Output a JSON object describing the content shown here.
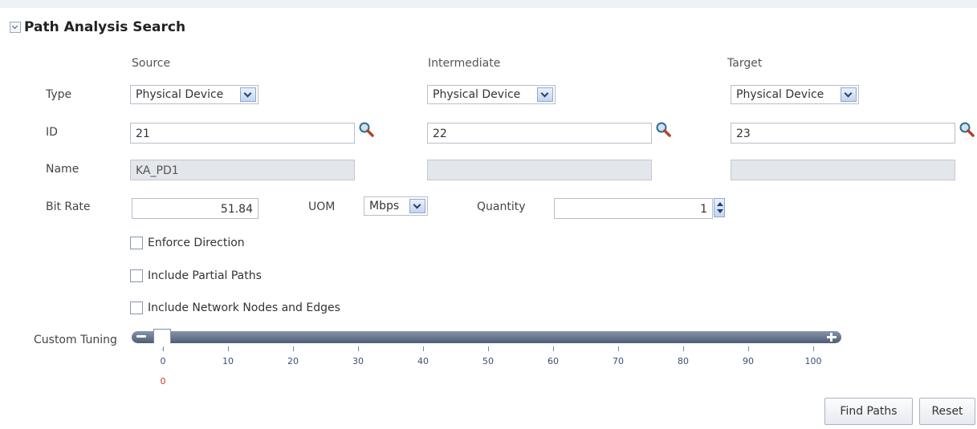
{
  "section": {
    "title": "Path Analysis Search"
  },
  "columns": {
    "source": "Source",
    "intermediate": "Intermediate",
    "target": "Target"
  },
  "labels": {
    "type": "Type",
    "id": "ID",
    "name": "Name",
    "bit_rate": "Bit Rate",
    "uom": "UOM",
    "quantity": "Quantity",
    "custom_tuning": "Custom Tuning"
  },
  "source": {
    "type": "Physical Device",
    "id": "21",
    "name": "KA_PD1"
  },
  "intermediate": {
    "type": "Physical Device",
    "id": "22",
    "name": ""
  },
  "target": {
    "type": "Physical Device",
    "id": "23",
    "name": ""
  },
  "bit_rate": "51.84",
  "uom": "Mbps",
  "quantity": "1",
  "options": {
    "enforce_direction": {
      "label": "Enforce Direction",
      "checked": false
    },
    "include_partial_paths": {
      "label": "Include Partial Paths",
      "checked": false
    },
    "include_network_nodes": {
      "label": "Include Network Nodes and Edges",
      "checked": false
    }
  },
  "slider": {
    "min": 0,
    "max": 100,
    "value": 0,
    "value_label": "0",
    "ticks": [
      "0",
      "10",
      "20",
      "30",
      "40",
      "50",
      "60",
      "70",
      "80",
      "90",
      "100"
    ]
  },
  "buttons": {
    "find_paths": "Find Paths",
    "reset": "Reset"
  },
  "icons": {
    "search": "magnifier-icon",
    "collapse": "collapse-icon"
  }
}
